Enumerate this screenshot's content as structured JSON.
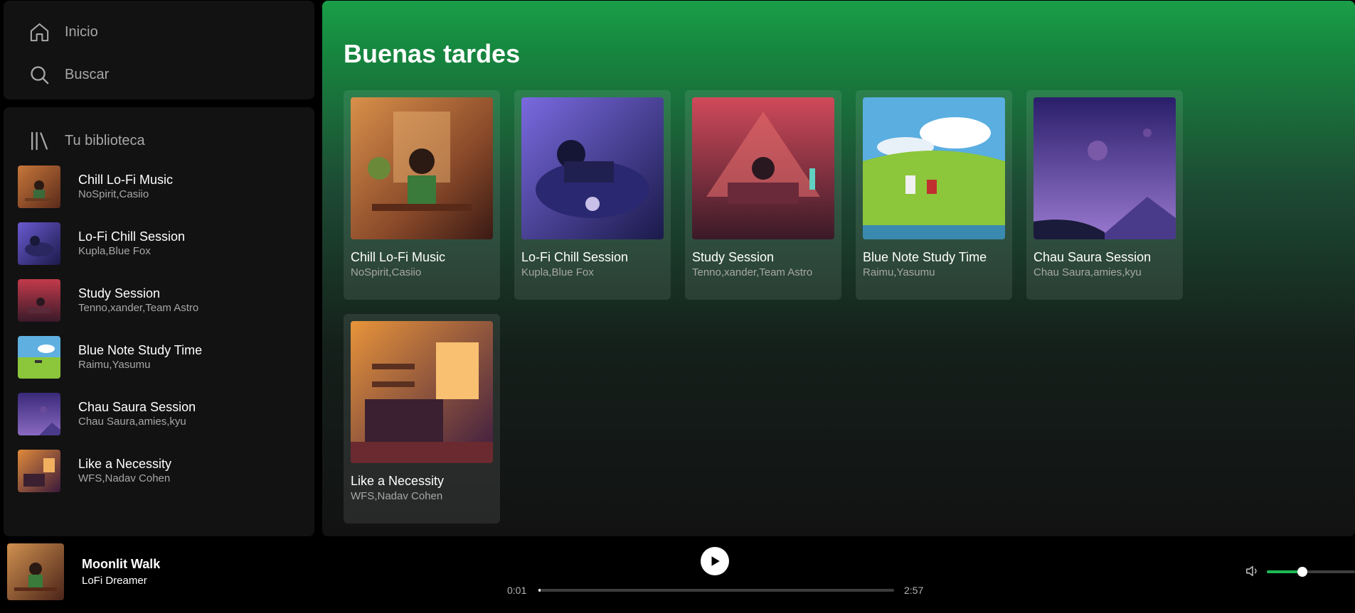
{
  "nav": {
    "home_label": "Inicio",
    "search_label": "Buscar",
    "home_icon": "home-icon",
    "search_icon": "search-icon"
  },
  "library": {
    "label": "Tu biblioteca",
    "icon": "library-icon",
    "items": [
      {
        "title": "Chill Lo-Fi Music",
        "artists": "NoSpirit,Casiio"
      },
      {
        "title": "Lo-Fi Chill Session",
        "artists": "Kupla,Blue Fox"
      },
      {
        "title": "Study Session",
        "artists": "Tenno,xander,Team Astro"
      },
      {
        "title": "Blue Note Study Time",
        "artists": "Raimu,Yasumu"
      },
      {
        "title": "Chau Saura Session",
        "artists": "Chau Saura,amies,kyu"
      },
      {
        "title": "Like a Necessity",
        "artists": "WFS,Nadav Cohen"
      }
    ]
  },
  "main": {
    "greeting": "Buenas tardes",
    "cards": [
      {
        "title": "Chill Lo-Fi Music",
        "artists": "NoSpirit,Casiio"
      },
      {
        "title": "Lo-Fi Chill Session",
        "artists": "Kupla,Blue Fox"
      },
      {
        "title": "Study Session",
        "artists": "Tenno,xander,Team Astro"
      },
      {
        "title": "Blue Note Study Time",
        "artists": "Raimu,Yasumu"
      },
      {
        "title": "Chau Saura Session",
        "artists": "Chau Saura,amies,kyu"
      },
      {
        "title": "Like a Necessity",
        "artists": "WFS,Nadav Cohen"
      }
    ]
  },
  "player": {
    "title": "Moonlit Walk",
    "artist": "LoFi Dreamer",
    "current_time": "0:01",
    "total_time": "2:57",
    "progress_fraction": 0.006,
    "volume_fraction": 0.4,
    "play_icon": "play-icon",
    "volume_icon": "volume-icon"
  },
  "colors": {
    "accent": "#1db954",
    "background": "#121212",
    "muted_text": "#a7a7a7"
  }
}
